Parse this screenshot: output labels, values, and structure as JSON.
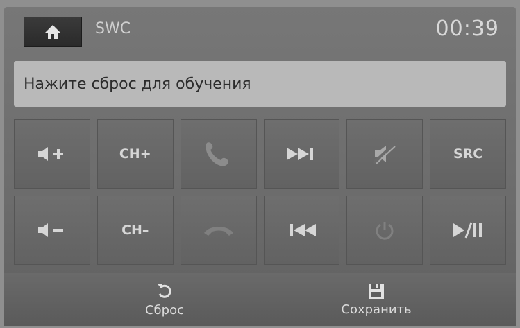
{
  "header": {
    "home_icon": "home-icon",
    "title": "SWC",
    "clock": "00:39"
  },
  "message": "Нажите сброс для обучения",
  "keys": [
    {
      "name": "volume-up",
      "icon": "volume-up-icon",
      "label": ""
    },
    {
      "name": "channel-up",
      "icon": "",
      "label": "CH+"
    },
    {
      "name": "call-answer",
      "icon": "phone-icon",
      "label": ""
    },
    {
      "name": "next-track",
      "icon": "next-track-icon",
      "label": ""
    },
    {
      "name": "mute",
      "icon": "mute-icon",
      "label": ""
    },
    {
      "name": "source",
      "icon": "",
      "label": "SRC"
    },
    {
      "name": "volume-down",
      "icon": "volume-down-icon",
      "label": ""
    },
    {
      "name": "channel-down",
      "icon": "",
      "label": "CH–"
    },
    {
      "name": "call-hangup",
      "icon": "hangup-icon",
      "label": ""
    },
    {
      "name": "previous-track",
      "icon": "previous-track-icon",
      "label": ""
    },
    {
      "name": "power",
      "icon": "power-icon",
      "label": ""
    },
    {
      "name": "play-pause",
      "icon": "play-pause-icon",
      "label": ""
    }
  ],
  "footer": {
    "reset_label": "Сброс",
    "save_label": "Сохранить",
    "reset_icon": "reset-icon",
    "save_icon": "save-icon"
  },
  "colors": {
    "background": "#8f8f8f",
    "message_bar": "#b9b9b9",
    "key": "#666666",
    "text": "#d6d6d6"
  }
}
